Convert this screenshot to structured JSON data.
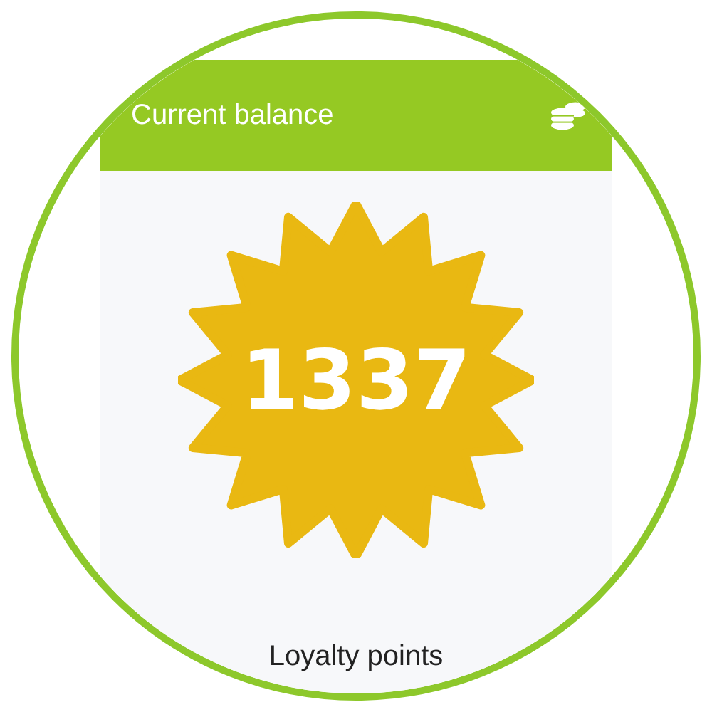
{
  "card": {
    "title": "Current balance",
    "value": "1337",
    "caption": "Loyalty points"
  }
}
